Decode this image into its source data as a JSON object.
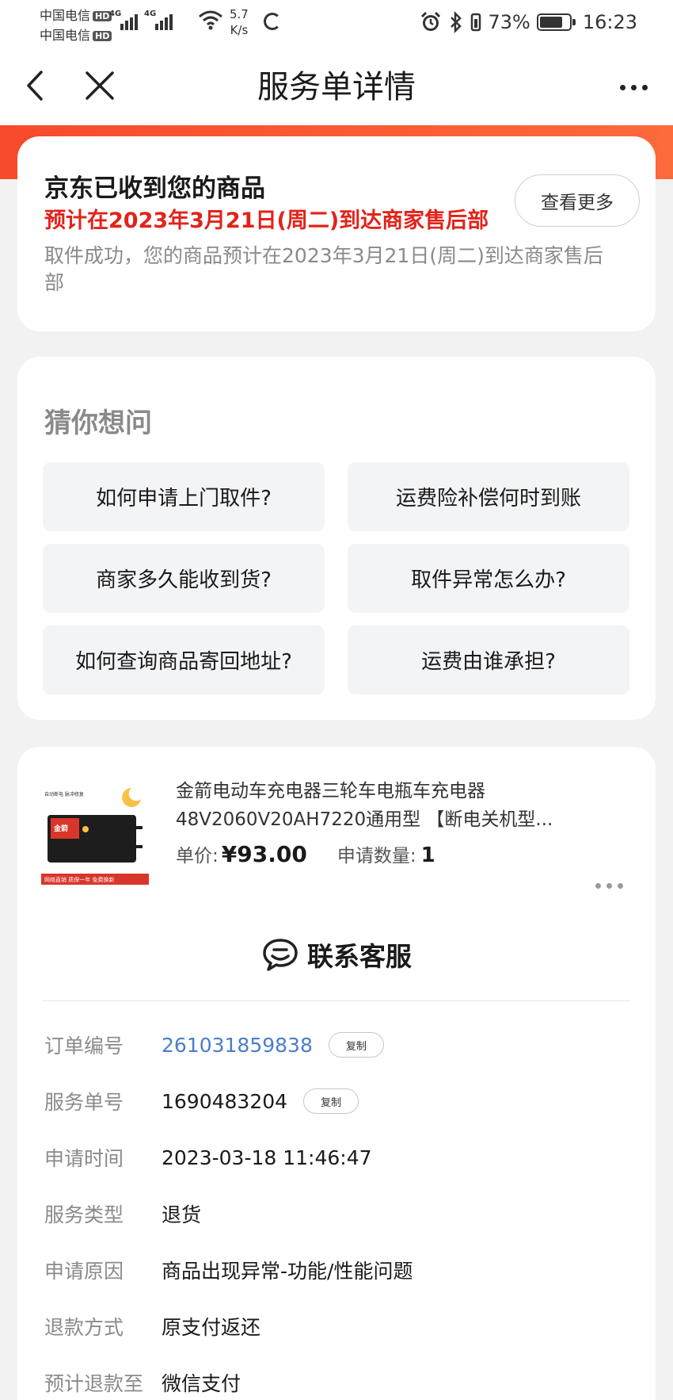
{
  "status_bar": {
    "carrier_1": "中国电信",
    "carrier_2": "中国电信",
    "hd_badge": "HD",
    "network_tag_1": "4G",
    "network_tag_2": "4G",
    "net_speed_value": "5.7",
    "net_speed_unit": "K/s",
    "battery_percent": "73%",
    "time": "16:23"
  },
  "nav": {
    "title": "服务单详情"
  },
  "status_card": {
    "title": "京东已收到您的商品",
    "eta": "预计在2023年3月21日(周二)到达商家售后部",
    "description": "取件成功，您的商品预计在2023年3月21日(周二)到达商家售后部",
    "view_more_label": "查看更多"
  },
  "faq": {
    "heading": "猜你想问",
    "items": [
      "如何申请上门取件?",
      "运费险补偿何时到账",
      "商家多久能收到货?",
      "取件异常怎么办?",
      "如何查询商品寄回地址?",
      "运费由谁承担?"
    ]
  },
  "product": {
    "name": "金箭电动车充电器三轮车电瓶车充电器48V2060V20AH7220通用型 【断电关机型...",
    "price_label": "单价:",
    "price_value": "¥93.00",
    "qty_label": "申请数量:",
    "qty_value": "1",
    "thumb_brand": "金箭",
    "thumb_text_1": "自动断电 脉冲修复",
    "thumb_text_2": "网络直销 质保一年 免费换新"
  },
  "contact": {
    "label": "联系客服"
  },
  "details": [
    {
      "label": "订单编号",
      "value": "261031859838",
      "copy": "复制"
    },
    {
      "label": "服务单号",
      "value": "1690483204",
      "copy": "复制"
    },
    {
      "label": "申请时间",
      "value": "2023-03-18 11:46:47"
    },
    {
      "label": "服务类型",
      "value": "退货"
    },
    {
      "label": "申请原因",
      "value": "商品出现异常-功能/性能问题"
    },
    {
      "label": "退款方式",
      "value": "原支付返还"
    },
    {
      "label": "预计退款至",
      "value": "微信支付"
    }
  ],
  "colors": {
    "accent_red": "#e2231a",
    "band_orange": "#f74a2c",
    "link_blue": "#4a7ecb"
  }
}
